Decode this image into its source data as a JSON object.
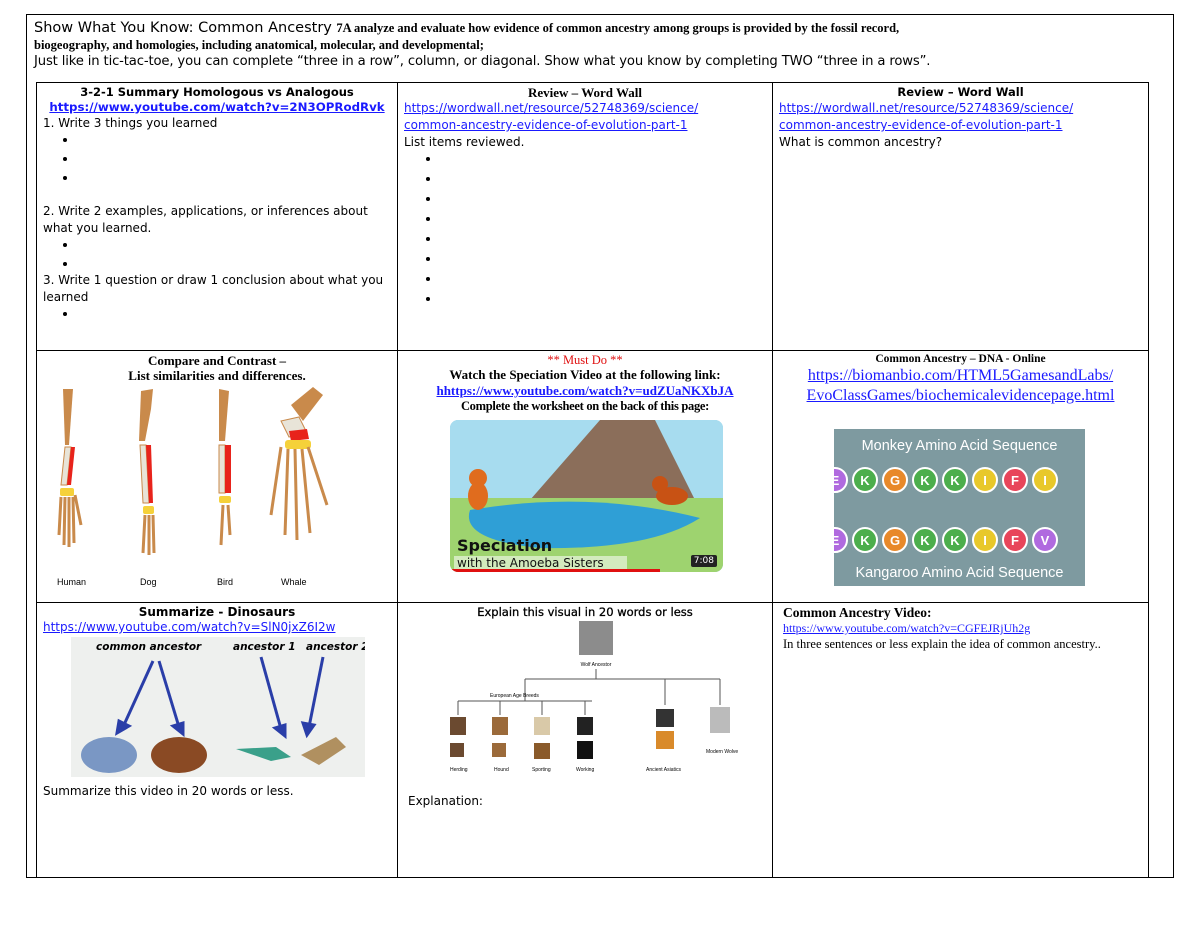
{
  "header": {
    "title": "Show What You Know: Common Ancestry",
    "standard_part1": "7A analyze and evaluate how evidence of common ancestry among groups is provided by the fossil record,",
    "standard_part2": "biogeography, and homologies, including anatomical, molecular, and developmental;",
    "instructions": "Just like in tic-tac-toe, you can complete “three in a row”, column, or diagonal.  Show what you know by completing TWO “three in a rows”."
  },
  "cells": {
    "c1": {
      "title": "3-2-1 Summary   Homologous vs Analogous",
      "link": "https://www.youtube.com/watch?v=2N3OPRodRvk",
      "q1": "1. Write 3 things you learned",
      "q2": "2. Write 2 examples, applications, or inferences about what you learned.",
      "q3": "3. Write 1 question or draw 1 conclusion about what you learned"
    },
    "c2": {
      "title": "Review – Word Wall",
      "link": "https://wordwall.net/resource/52748369/science/common-ancestry-evidence-of-evolution-part-1",
      "link_line1": "https://wordwall.net/resource/52748369/science/",
      "link_line2": "common-ancestry-evidence-of-evolution-part-1",
      "prompt": "List items reviewed."
    },
    "c3": {
      "title": "Review – Word Wall",
      "link_line1": "https://wordwall.net/resource/52748369/science/",
      "link_line2": "common-ancestry-evidence-of-evolution-part-1",
      "prompt": "What is common ancestry?"
    },
    "c4": {
      "title_line1": "Compare and Contrast –",
      "title_line2": "List similarities and differences.",
      "labels": [
        "Human",
        "Dog",
        "Bird",
        "Whale"
      ]
    },
    "c5": {
      "must": "** Must Do **",
      "line1": "Watch the Speciation Video at the following link:",
      "link": "hhttps://www.youtube.com/watch?v=udZUaNKXbJA",
      "line3": "Complete the worksheet on the back of this page:",
      "video_title": "Speciation",
      "video_sub": "with the Amoeba Sisters",
      "video_time": "7:08"
    },
    "c6": {
      "title": "Common Ancestry – DNA -  Online",
      "link_line1": "https://biomanbio.com/HTML5GamesandLabs/",
      "link_line2": "EvoClassGames/biochemicalevidencepage.html",
      "top_caption": "Monkey Amino Acid Sequence",
      "bottom_caption": "Kangaroo Amino Acid Sequence",
      "top_seq": [
        "E",
        "K",
        "G",
        "K",
        "K",
        "I",
        "F",
        "I"
      ],
      "bottom_seq": [
        "E",
        "K",
        "G",
        "K",
        "K",
        "I",
        "F",
        "V"
      ]
    },
    "c7": {
      "title": "Summarize - Dinosaurs",
      "link": "https://www.youtube.com/watch?v=SlN0jxZ6I2w",
      "label_common": "common ancestor",
      "label_a1": "ancestor 1",
      "label_a2": "ancestor 2",
      "prompt": "Summarize this video in 20 words or less."
    },
    "c8": {
      "title": "Explain this visual in 20 words or less",
      "prompt": "Explanation:",
      "tree_root": "Wolf Ancestor",
      "tree_mid": "European Age Breeds",
      "tree_labels": [
        "Herding",
        "Hound",
        "Sporting",
        "Working",
        "Ancient Asiatics",
        "Modern Wolve"
      ]
    },
    "c9": {
      "title": "Common Ancestry Video:",
      "link": "https://www.youtube.com/watch?v=CGFEJRjUh2g",
      "prompt": "In three sentences or less explain the idea of common ancestry.."
    }
  },
  "colors": {
    "link": "#1a1aff",
    "must_do": "#e01010",
    "bone": "#c98a4b",
    "highlight_red": "#e8231b",
    "highlight_yellow": "#f5d13a",
    "amino_bg": "#7e9aa0"
  }
}
